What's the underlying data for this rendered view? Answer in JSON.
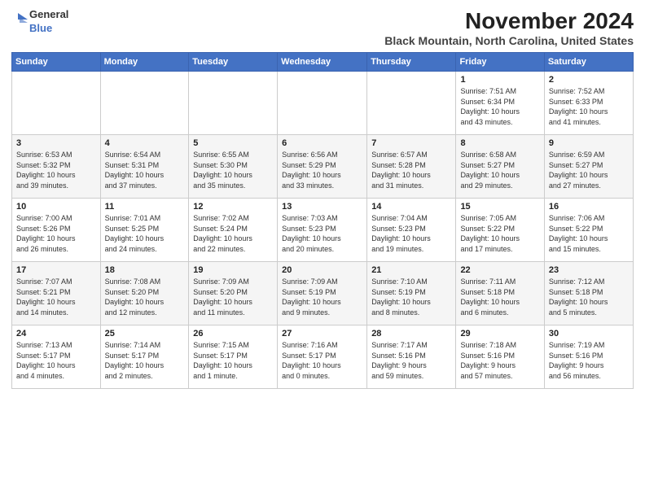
{
  "logo": {
    "line1": "General",
    "line2": "Blue"
  },
  "title": "November 2024",
  "location": "Black Mountain, North Carolina, United States",
  "weekdays": [
    "Sunday",
    "Monday",
    "Tuesday",
    "Wednesday",
    "Thursday",
    "Friday",
    "Saturday"
  ],
  "weeks": [
    [
      {
        "day": "",
        "info": ""
      },
      {
        "day": "",
        "info": ""
      },
      {
        "day": "",
        "info": ""
      },
      {
        "day": "",
        "info": ""
      },
      {
        "day": "",
        "info": ""
      },
      {
        "day": "1",
        "info": "Sunrise: 7:51 AM\nSunset: 6:34 PM\nDaylight: 10 hours\nand 43 minutes."
      },
      {
        "day": "2",
        "info": "Sunrise: 7:52 AM\nSunset: 6:33 PM\nDaylight: 10 hours\nand 41 minutes."
      }
    ],
    [
      {
        "day": "3",
        "info": "Sunrise: 6:53 AM\nSunset: 5:32 PM\nDaylight: 10 hours\nand 39 minutes."
      },
      {
        "day": "4",
        "info": "Sunrise: 6:54 AM\nSunset: 5:31 PM\nDaylight: 10 hours\nand 37 minutes."
      },
      {
        "day": "5",
        "info": "Sunrise: 6:55 AM\nSunset: 5:30 PM\nDaylight: 10 hours\nand 35 minutes."
      },
      {
        "day": "6",
        "info": "Sunrise: 6:56 AM\nSunset: 5:29 PM\nDaylight: 10 hours\nand 33 minutes."
      },
      {
        "day": "7",
        "info": "Sunrise: 6:57 AM\nSunset: 5:28 PM\nDaylight: 10 hours\nand 31 minutes."
      },
      {
        "day": "8",
        "info": "Sunrise: 6:58 AM\nSunset: 5:27 PM\nDaylight: 10 hours\nand 29 minutes."
      },
      {
        "day": "9",
        "info": "Sunrise: 6:59 AM\nSunset: 5:27 PM\nDaylight: 10 hours\nand 27 minutes."
      }
    ],
    [
      {
        "day": "10",
        "info": "Sunrise: 7:00 AM\nSunset: 5:26 PM\nDaylight: 10 hours\nand 26 minutes."
      },
      {
        "day": "11",
        "info": "Sunrise: 7:01 AM\nSunset: 5:25 PM\nDaylight: 10 hours\nand 24 minutes."
      },
      {
        "day": "12",
        "info": "Sunrise: 7:02 AM\nSunset: 5:24 PM\nDaylight: 10 hours\nand 22 minutes."
      },
      {
        "day": "13",
        "info": "Sunrise: 7:03 AM\nSunset: 5:23 PM\nDaylight: 10 hours\nand 20 minutes."
      },
      {
        "day": "14",
        "info": "Sunrise: 7:04 AM\nSunset: 5:23 PM\nDaylight: 10 hours\nand 19 minutes."
      },
      {
        "day": "15",
        "info": "Sunrise: 7:05 AM\nSunset: 5:22 PM\nDaylight: 10 hours\nand 17 minutes."
      },
      {
        "day": "16",
        "info": "Sunrise: 7:06 AM\nSunset: 5:22 PM\nDaylight: 10 hours\nand 15 minutes."
      }
    ],
    [
      {
        "day": "17",
        "info": "Sunrise: 7:07 AM\nSunset: 5:21 PM\nDaylight: 10 hours\nand 14 minutes."
      },
      {
        "day": "18",
        "info": "Sunrise: 7:08 AM\nSunset: 5:20 PM\nDaylight: 10 hours\nand 12 minutes."
      },
      {
        "day": "19",
        "info": "Sunrise: 7:09 AM\nSunset: 5:20 PM\nDaylight: 10 hours\nand 11 minutes."
      },
      {
        "day": "20",
        "info": "Sunrise: 7:09 AM\nSunset: 5:19 PM\nDaylight: 10 hours\nand 9 minutes."
      },
      {
        "day": "21",
        "info": "Sunrise: 7:10 AM\nSunset: 5:19 PM\nDaylight: 10 hours\nand 8 minutes."
      },
      {
        "day": "22",
        "info": "Sunrise: 7:11 AM\nSunset: 5:18 PM\nDaylight: 10 hours\nand 6 minutes."
      },
      {
        "day": "23",
        "info": "Sunrise: 7:12 AM\nSunset: 5:18 PM\nDaylight: 10 hours\nand 5 minutes."
      }
    ],
    [
      {
        "day": "24",
        "info": "Sunrise: 7:13 AM\nSunset: 5:17 PM\nDaylight: 10 hours\nand 4 minutes."
      },
      {
        "day": "25",
        "info": "Sunrise: 7:14 AM\nSunset: 5:17 PM\nDaylight: 10 hours\nand 2 minutes."
      },
      {
        "day": "26",
        "info": "Sunrise: 7:15 AM\nSunset: 5:17 PM\nDaylight: 10 hours\nand 1 minute."
      },
      {
        "day": "27",
        "info": "Sunrise: 7:16 AM\nSunset: 5:17 PM\nDaylight: 10 hours\nand 0 minutes."
      },
      {
        "day": "28",
        "info": "Sunrise: 7:17 AM\nSunset: 5:16 PM\nDaylight: 9 hours\nand 59 minutes."
      },
      {
        "day": "29",
        "info": "Sunrise: 7:18 AM\nSunset: 5:16 PM\nDaylight: 9 hours\nand 57 minutes."
      },
      {
        "day": "30",
        "info": "Sunrise: 7:19 AM\nSunset: 5:16 PM\nDaylight: 9 hours\nand 56 minutes."
      }
    ]
  ]
}
